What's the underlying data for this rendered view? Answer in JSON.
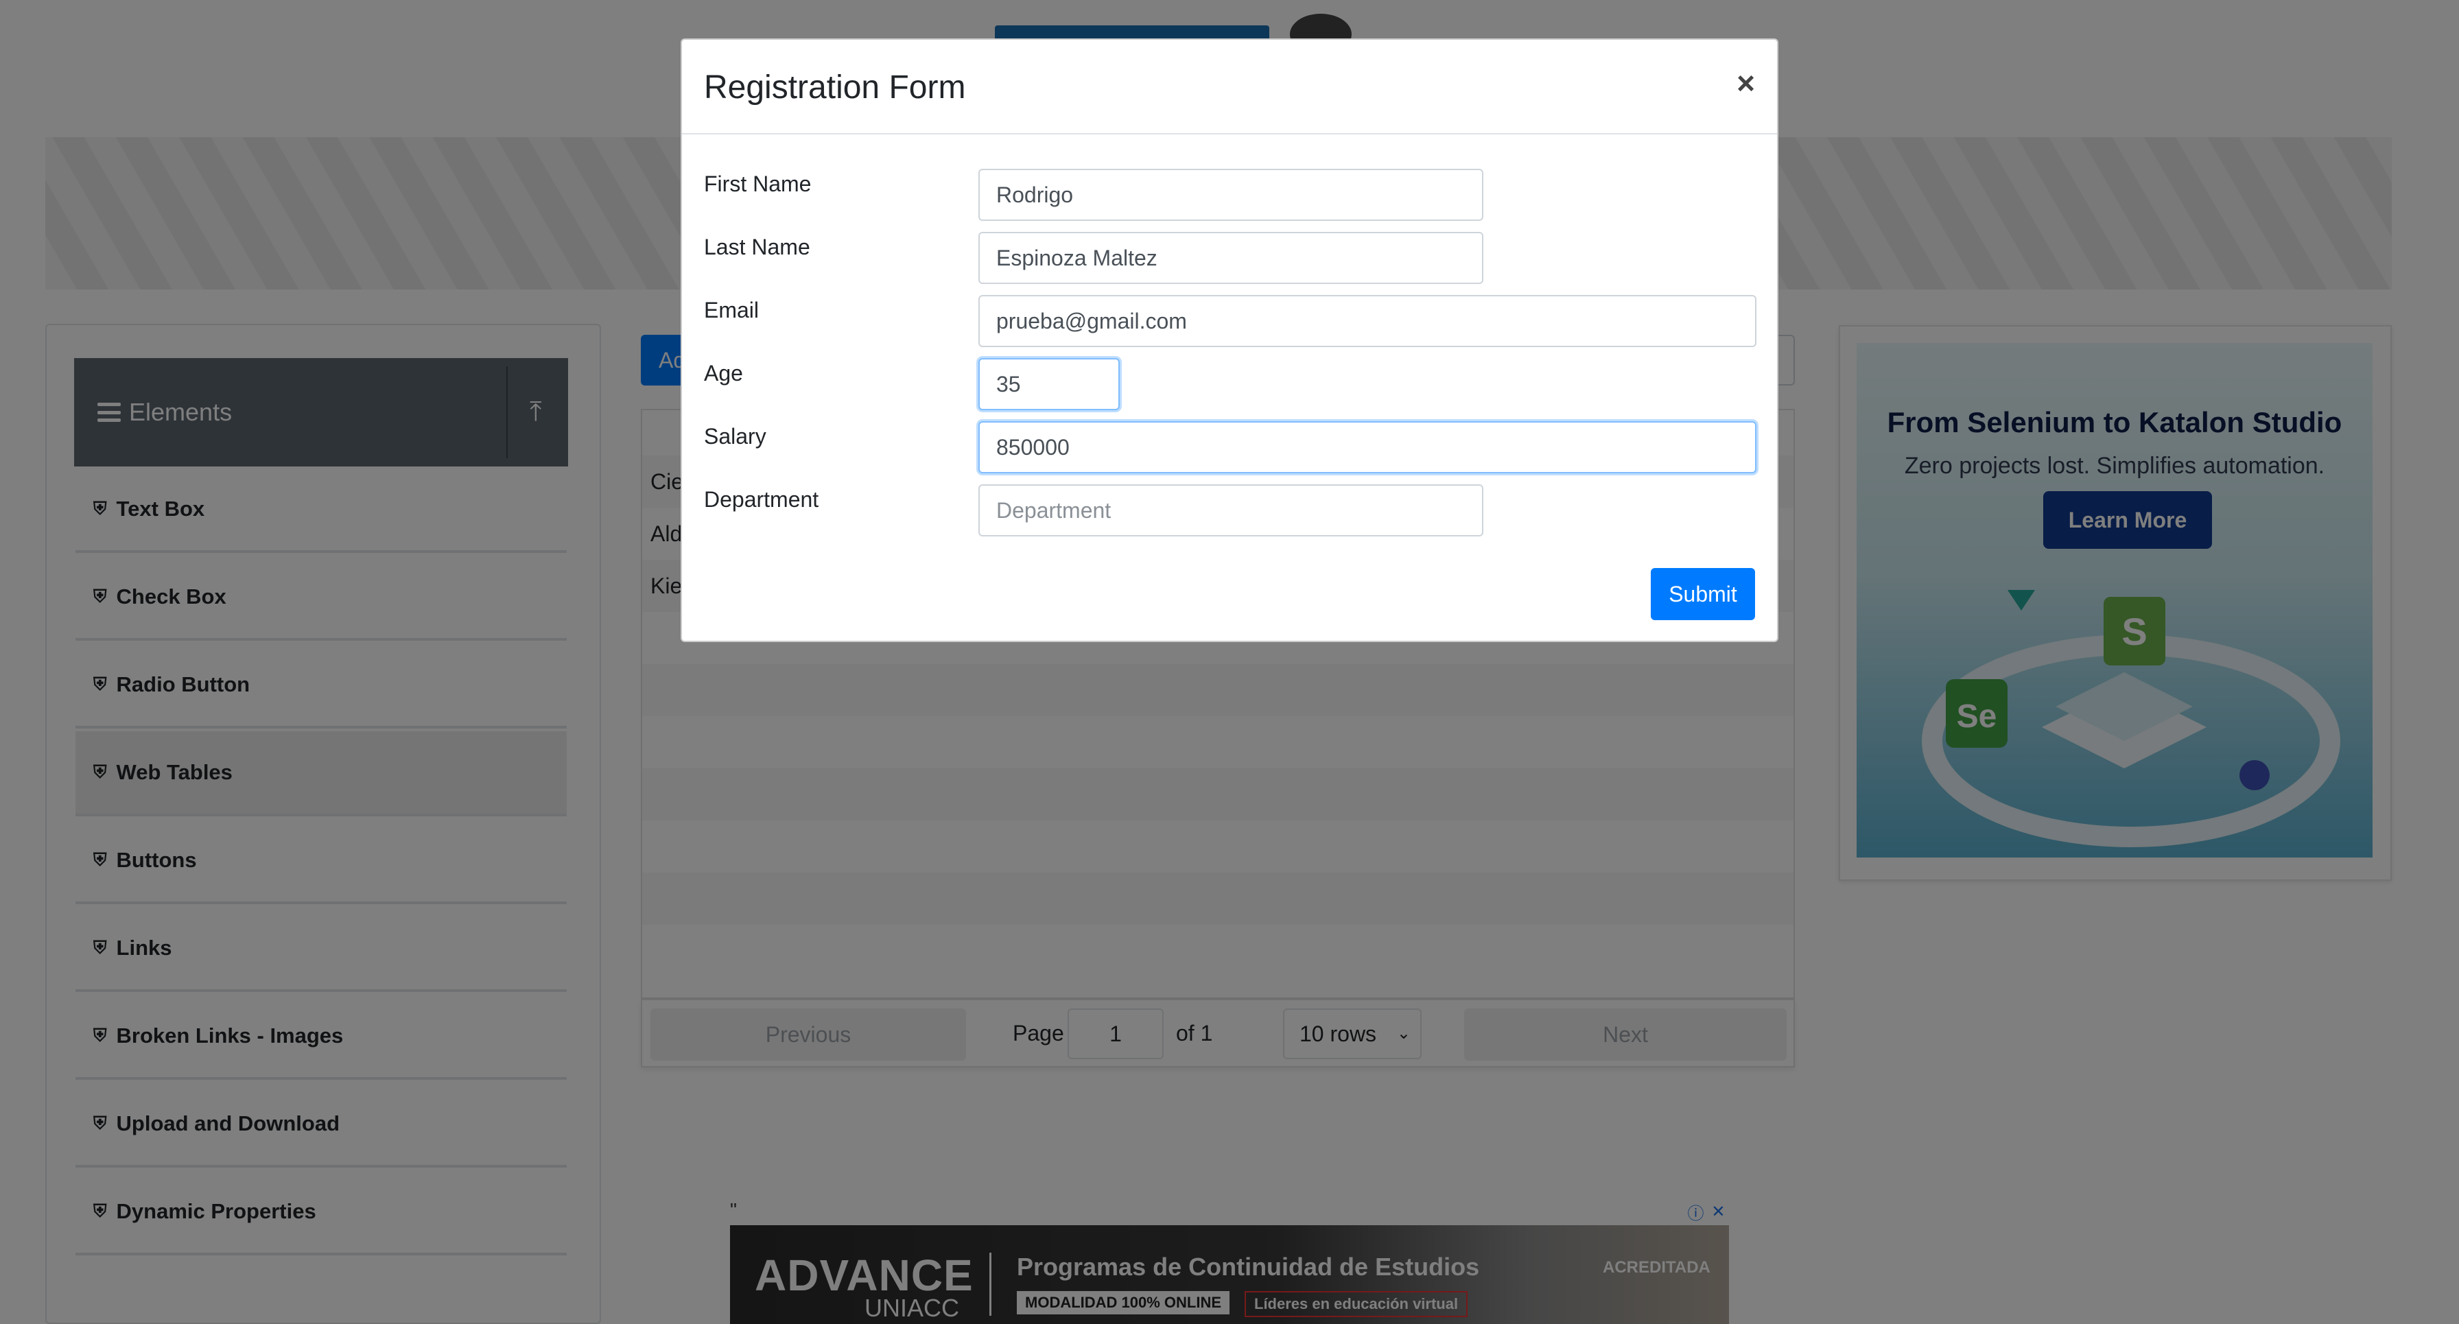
{
  "sidebar": {
    "group_title": "Elements",
    "items": [
      {
        "label": "Text Box"
      },
      {
        "label": "Check Box"
      },
      {
        "label": "Radio Button"
      },
      {
        "label": "Web Tables"
      },
      {
        "label": "Buttons"
      },
      {
        "label": "Links"
      },
      {
        "label": "Broken Links - Images"
      },
      {
        "label": "Upload and Download"
      },
      {
        "label": "Dynamic Properties"
      }
    ],
    "active": "Web Tables"
  },
  "table": {
    "add_label": "Ad",
    "row_peeks": [
      "Cie",
      "Ald",
      "Kier"
    ]
  },
  "pagination": {
    "previous_label": "Previous",
    "next_label": "Next",
    "page_label": "Page",
    "page_value": "1",
    "of_label": "of 1",
    "rows_label": "10 rows"
  },
  "ad_right": {
    "title": "From Selenium to Katalon Studio",
    "subtitle": "Zero projects lost. Simplifies automation.",
    "button": "Learn More",
    "art_labels": [
      "S",
      "Se"
    ]
  },
  "ad_bottom": {
    "quote": "\"",
    "brand": "ADVANCE",
    "brand_sub": "UNIACC",
    "headline": "Programas de Continuidad de Estudios",
    "tag1": "MODALIDAD 100% ONLINE",
    "tag2": "Líderes en educación virtual",
    "accredited": "ACREDITADA"
  },
  "modal": {
    "title": "Registration Form",
    "close": "×",
    "fields": {
      "first_name": {
        "label": "First Name",
        "value": "Rodrigo"
      },
      "last_name": {
        "label": "Last Name",
        "value": "Espinoza Maltez"
      },
      "email": {
        "label": "Email",
        "value": "prueba@gmail.com"
      },
      "age": {
        "label": "Age",
        "value": "35"
      },
      "salary": {
        "label": "Salary",
        "value": "850000"
      },
      "department": {
        "label": "Department",
        "value": "",
        "placeholder": "Department"
      }
    },
    "submit": "Submit"
  },
  "colors": {
    "primary": "#007bff",
    "sidebar_header": "#5c6770",
    "overlay": "rgba(0,0,0,0.5)"
  }
}
